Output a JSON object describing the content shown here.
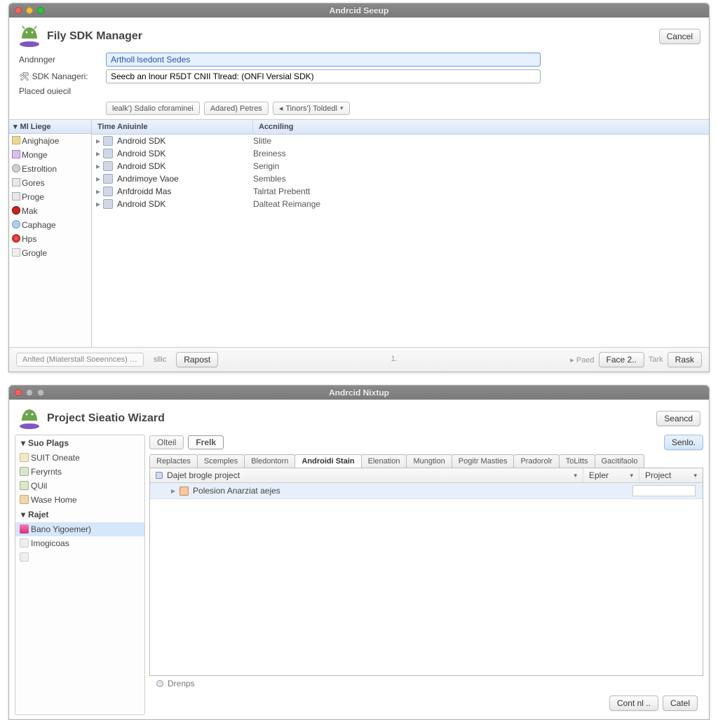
{
  "window1": {
    "title": "Andrcid Seeup",
    "header": "Fily SDK Manager",
    "cancel": "Cancel",
    "form": {
      "label1": "Andnnger",
      "input1": "Artholl lsedont Sedes",
      "label2": "SDK Nanageri:",
      "input2": "Seecb an lnour R5DT CNII Tlread: (ONFl Versial SDK)",
      "label3": "Placed ouiecil",
      "combo1": "lealk') Sdalio cforaminei",
      "combo2": "Adared) Petres",
      "combo3": "Tinors') Toldedl"
    },
    "sidebar": {
      "head": "Ml Liege",
      "items": [
        {
          "label": "Anighajoe",
          "icon": "ic-box"
        },
        {
          "label": "Monge",
          "icon": "ic-db"
        },
        {
          "label": "Estroltion",
          "icon": "ic-gear"
        },
        {
          "label": "Gores",
          "icon": "ic-fold"
        },
        {
          "label": "Proge",
          "icon": "ic-fold"
        },
        {
          "label": "Mak",
          "icon": "ic-dot"
        },
        {
          "label": "Caphage",
          "icon": "ic-globe"
        },
        {
          "label": "Hps",
          "icon": "ic-ball"
        },
        {
          "label": "Grogle",
          "icon": "ic-g"
        }
      ]
    },
    "tree": {
      "col1": "Time Aniuinle",
      "col2": "Accniling",
      "rows": [
        {
          "name": "Android SDK",
          "act": "Slitle"
        },
        {
          "name": "Android SDK",
          "act": "Breiness"
        },
        {
          "name": "Android SDK",
          "act": "Serigin"
        },
        {
          "name": "Andrimoye Vaoe",
          "act": "Sembles"
        },
        {
          "name": "Anfdroidd Mas",
          "act": "Talrtat Prebentt"
        },
        {
          "name": "Android SDK",
          "act": "Dalteat Reimange"
        }
      ]
    },
    "footer": {
      "left": "Anlted (Miaterstall Soeennces) …",
      "sllic": "sllic",
      "rapost": "Rapost",
      "center": "1.",
      "paed": "Paed",
      "face": "Face 2..",
      "tark": "Tark",
      "rask": "Rask"
    }
  },
  "window2": {
    "title": "Andrcid Nixtup",
    "header": "Project Sieatio Wizard",
    "seancd": "Seancd",
    "sidebar": {
      "head1": "Suo Plags",
      "items1": [
        {
          "label": "SUIT Oneate",
          "icon": "ic-card"
        },
        {
          "label": "Feryrnts",
          "icon": "ic-grid"
        },
        {
          "label": "QUil",
          "icon": "ic-grid"
        },
        {
          "label": "Wase Home",
          "icon": "ic-home"
        }
      ],
      "head2": "Rajet",
      "items2": [
        {
          "label": "Bano Yigoemer)",
          "icon": "ic-wiz",
          "sel": true
        },
        {
          "label": "Imogicoas",
          "icon": "ic-blank"
        },
        {
          "label": "",
          "icon": "ic-blank"
        }
      ]
    },
    "toolbar": {
      "oftel": "Olteil",
      "frell": "Frelk",
      "senlo": "Senlo."
    },
    "tabs": [
      "Replactes",
      "Scemples",
      "Bledontorn",
      "Androidi Stain",
      "Elenation",
      "Mungtion",
      "Pogitr Masties",
      "Pradorolr",
      "ToLitts",
      "Gacitifaolo"
    ],
    "active_tab": 3,
    "panel": {
      "col1": "Dajet brogle project",
      "col2": "Epler",
      "col3": "Project",
      "row1": "Polesion Anarziat aejes"
    },
    "status": "Drenps",
    "footer": {
      "cont": "Cont nl ..",
      "catel": "Catel"
    }
  }
}
